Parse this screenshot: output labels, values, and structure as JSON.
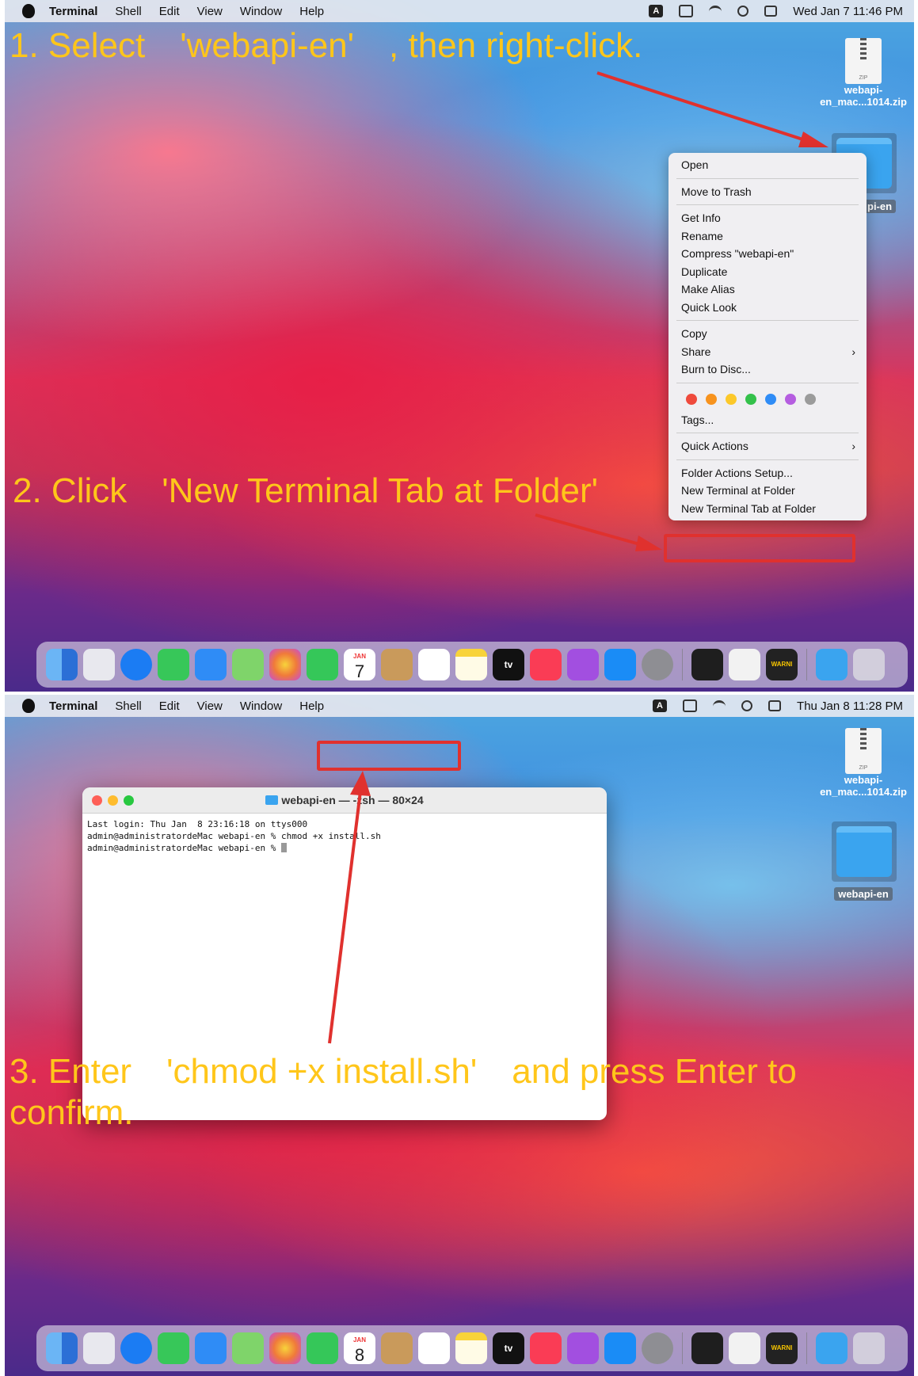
{
  "panel1": {
    "menubar": {
      "app": "Terminal",
      "items": [
        "Shell",
        "Edit",
        "View",
        "Window",
        "Help"
      ],
      "input_badge": "A",
      "clock": "Wed Jan 7  11:46 PM"
    },
    "instruction_1": "1. Select　'webapi-en'　, then right-click.",
    "instruction_2": "2. Click　'New Terminal Tab at Folder'",
    "desktop": {
      "zip_label_1": "webapi-",
      "zip_label_2": "en_mac...1014.zip",
      "zip_badge": "ZIP",
      "folder_label_partial": "pi-en"
    },
    "context_menu": {
      "open": "Open",
      "move_to_trash": "Move to Trash",
      "get_info": "Get Info",
      "rename": "Rename",
      "compress": "Compress \"webapi-en\"",
      "duplicate": "Duplicate",
      "make_alias": "Make Alias",
      "quick_look": "Quick Look",
      "copy": "Copy",
      "share": "Share",
      "burn": "Burn to Disc...",
      "tag_colors": [
        "#ef4a3c",
        "#f7931e",
        "#fcc82a",
        "#34c14b",
        "#2f8cf6",
        "#b55de0",
        "#9b9b9b"
      ],
      "tags": "Tags...",
      "quick_actions": "Quick Actions",
      "folder_actions": "Folder Actions Setup...",
      "new_terminal": "New Terminal at Folder",
      "new_terminal_tab": "New Terminal Tab at Folder"
    },
    "dock": {
      "calendar_month": "JAN",
      "calendar_day": "7",
      "tv_label": "tv",
      "warning_label": "WARNI"
    }
  },
  "panel2": {
    "menubar": {
      "app": "Terminal",
      "items": [
        "Shell",
        "Edit",
        "View",
        "Window",
        "Help"
      ],
      "input_badge": "A",
      "clock": "Thu Jan 8  11:28 PM"
    },
    "instruction_3_line1": "3. Enter　'chmod +x install.sh'　and press Enter to",
    "instruction_3_line2": "confirm.",
    "desktop": {
      "zip_label_1": "webapi-",
      "zip_label_2": "en_mac...1014.zip",
      "zip_badge": "ZIP",
      "folder_label": "webapi-en"
    },
    "terminal": {
      "title": "webapi-en — -zsh — 80×24",
      "line1": "Last login: Thu Jan  8 23:16:18 on ttys000",
      "line2_prompt": "admin@administratordeMac webapi-en % ",
      "line2_cmd": "chmod +x install.sh",
      "line3_prompt": "admin@administratordeMac webapi-en % "
    },
    "dock": {
      "calendar_month": "JAN",
      "calendar_day": "8",
      "tv_label": "tv",
      "warning_label": "WARNI"
    }
  }
}
